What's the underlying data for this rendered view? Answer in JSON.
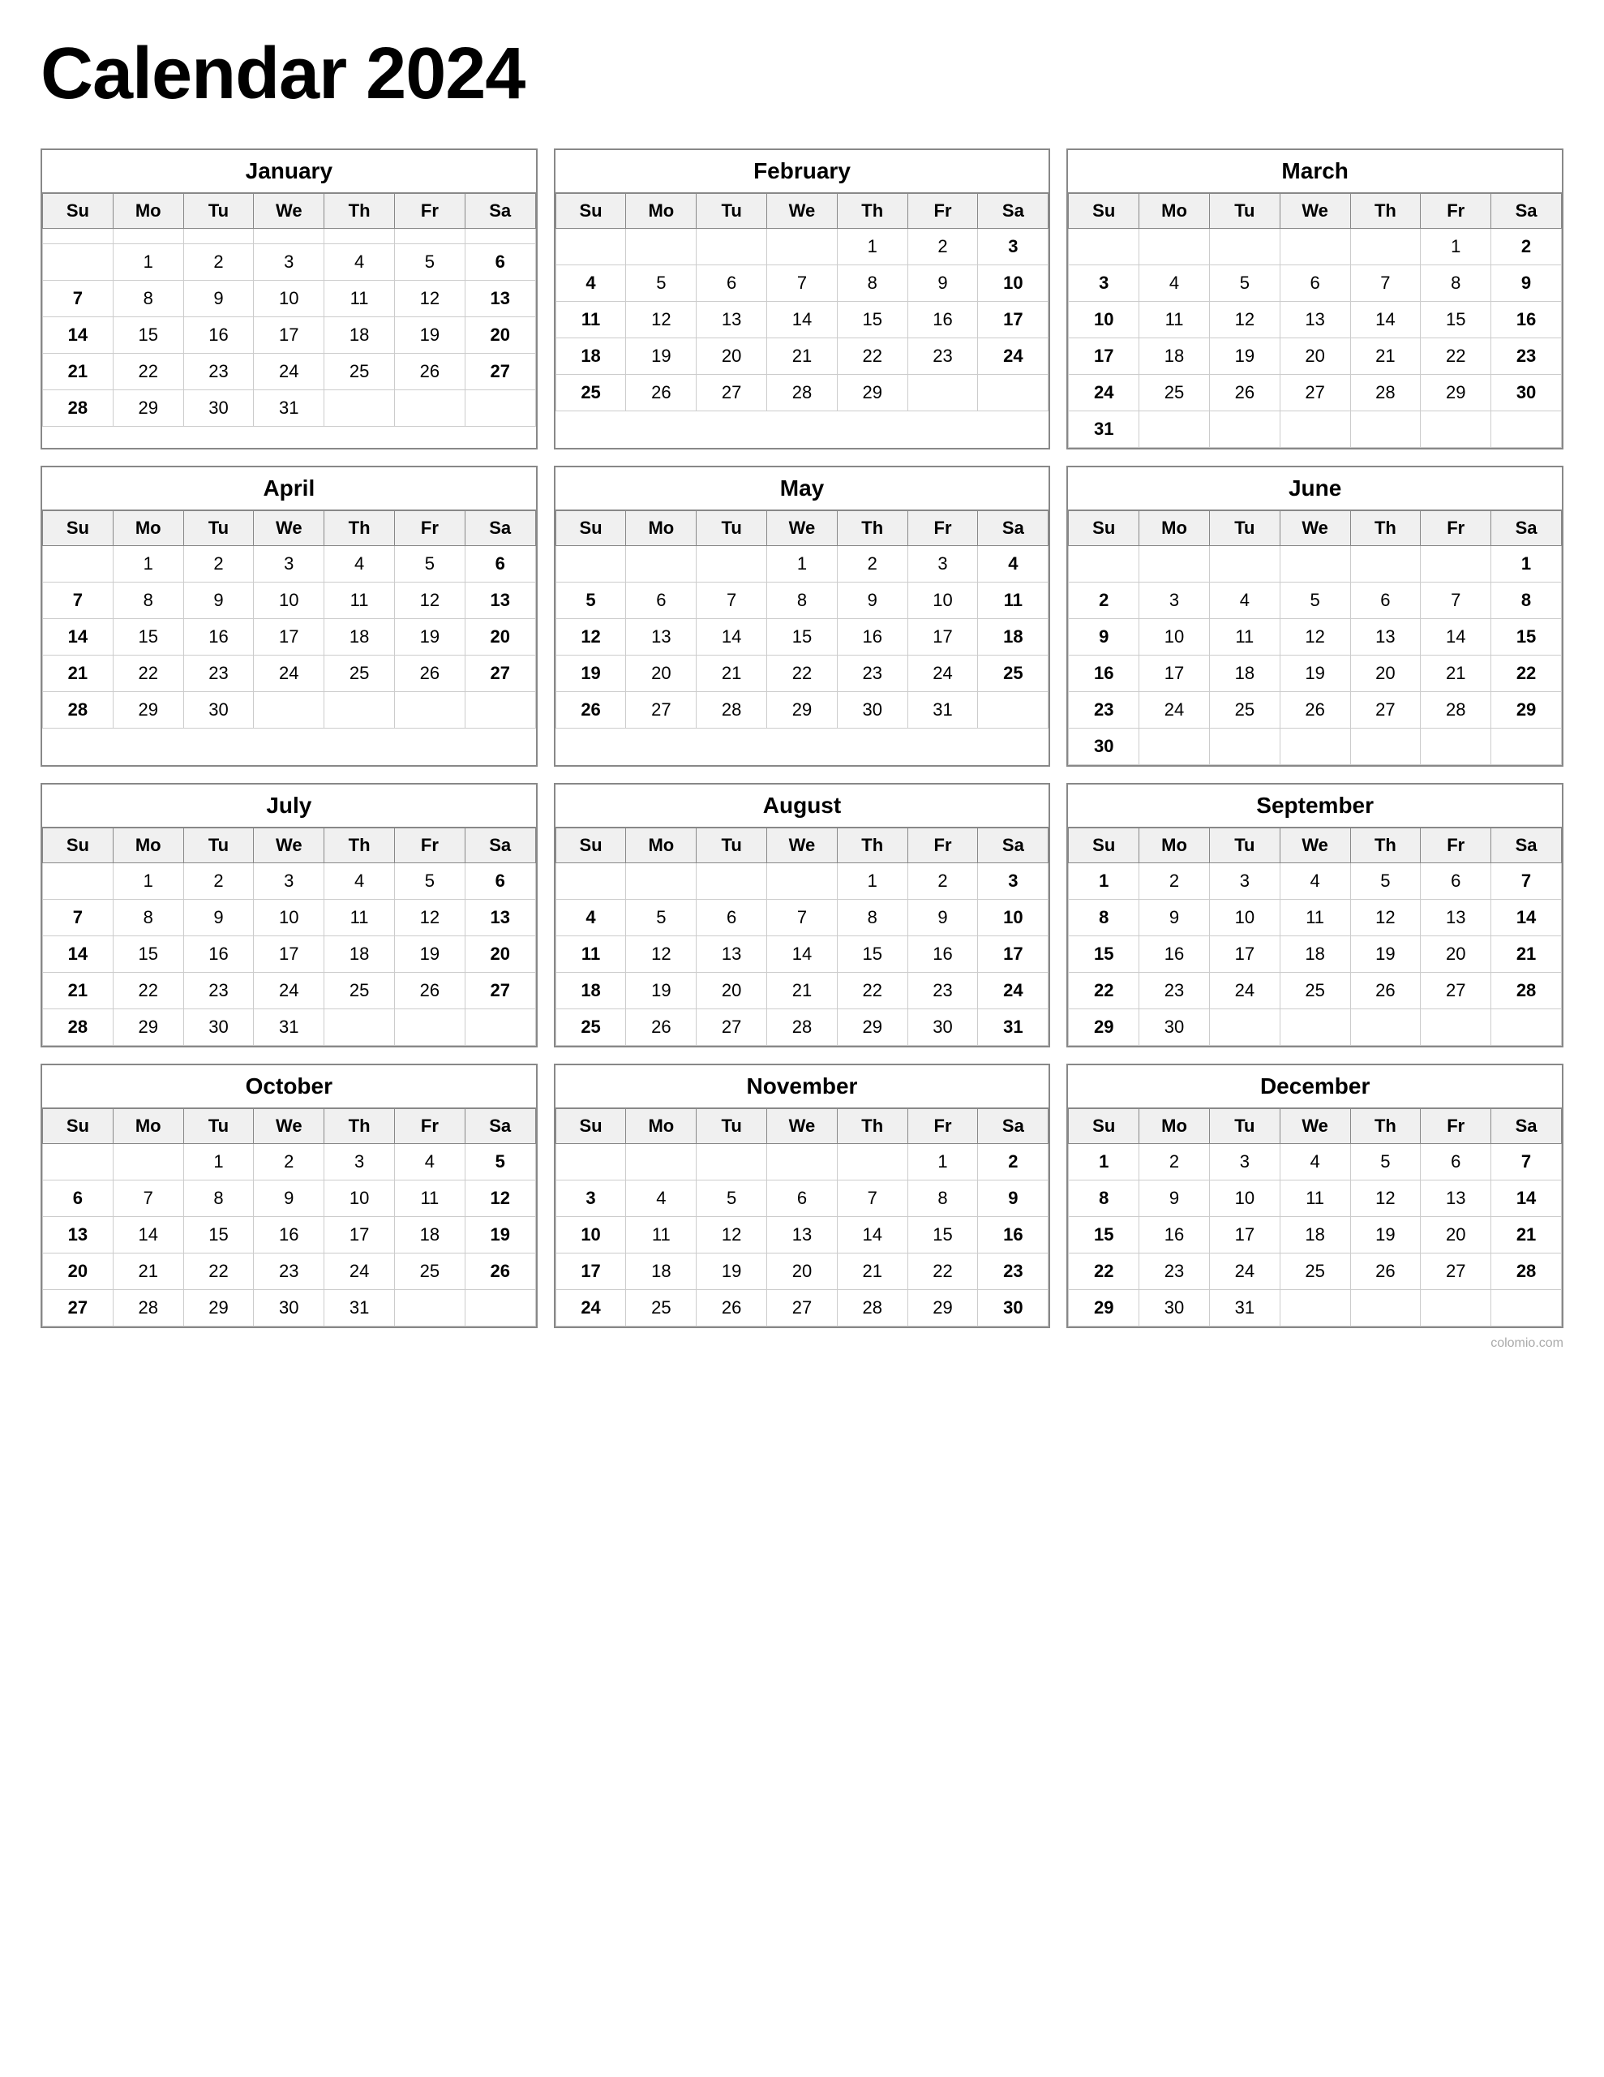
{
  "title": "Calendar 2024",
  "months": [
    {
      "name": "January",
      "headers": [
        "Su",
        "Mo",
        "Tu",
        "We",
        "Th",
        "Fr",
        "Sa"
      ],
      "weeks": [
        [
          "",
          "",
          "",
          "",
          "",
          "",
          ""
        ],
        [
          "",
          "1",
          "2",
          "3",
          "4",
          "5",
          "6"
        ],
        [
          "7",
          "8",
          "9",
          "10",
          "11",
          "12",
          "13"
        ],
        [
          "14",
          "15",
          "16",
          "17",
          "18",
          "19",
          "20"
        ],
        [
          "21",
          "22",
          "23",
          "24",
          "25",
          "26",
          "27"
        ],
        [
          "28",
          "29",
          "30",
          "31",
          "",
          "",
          ""
        ]
      ],
      "bold_cols": [
        0,
        6
      ]
    },
    {
      "name": "February",
      "headers": [
        "Su",
        "Mo",
        "Tu",
        "We",
        "Th",
        "Fr",
        "Sa"
      ],
      "weeks": [
        [
          "",
          "",
          "",
          "",
          "1",
          "2",
          "3"
        ],
        [
          "4",
          "5",
          "6",
          "7",
          "8",
          "9",
          "10"
        ],
        [
          "11",
          "12",
          "13",
          "14",
          "15",
          "16",
          "17"
        ],
        [
          "18",
          "19",
          "20",
          "21",
          "22",
          "23",
          "24"
        ],
        [
          "25",
          "26",
          "27",
          "28",
          "29",
          "",
          ""
        ]
      ],
      "bold_cols": [
        0,
        6
      ]
    },
    {
      "name": "March",
      "headers": [
        "Su",
        "Mo",
        "Tu",
        "We",
        "Th",
        "Fr",
        "Sa"
      ],
      "weeks": [
        [
          "",
          "",
          "",
          "",
          "",
          "1",
          "2"
        ],
        [
          "3",
          "4",
          "5",
          "6",
          "7",
          "8",
          "9"
        ],
        [
          "10",
          "11",
          "12",
          "13",
          "14",
          "15",
          "16"
        ],
        [
          "17",
          "18",
          "19",
          "20",
          "21",
          "22",
          "23"
        ],
        [
          "24",
          "25",
          "26",
          "27",
          "28",
          "29",
          "30"
        ],
        [
          "31",
          "",
          "",
          "",
          "",
          "",
          ""
        ]
      ],
      "bold_cols": [
        0,
        6
      ]
    },
    {
      "name": "April",
      "headers": [
        "Su",
        "Mo",
        "Tu",
        "We",
        "Th",
        "Fr",
        "Sa"
      ],
      "weeks": [
        [
          "",
          "1",
          "2",
          "3",
          "4",
          "5",
          "6"
        ],
        [
          "7",
          "8",
          "9",
          "10",
          "11",
          "12",
          "13"
        ],
        [
          "14",
          "15",
          "16",
          "17",
          "18",
          "19",
          "20"
        ],
        [
          "21",
          "22",
          "23",
          "24",
          "25",
          "26",
          "27"
        ],
        [
          "28",
          "29",
          "30",
          "",
          "",
          "",
          ""
        ]
      ],
      "bold_cols": [
        0,
        6
      ]
    },
    {
      "name": "May",
      "headers": [
        "Su",
        "Mo",
        "Tu",
        "We",
        "Th",
        "Fr",
        "Sa"
      ],
      "weeks": [
        [
          "",
          "",
          "",
          "1",
          "2",
          "3",
          "4"
        ],
        [
          "5",
          "6",
          "7",
          "8",
          "9",
          "10",
          "11"
        ],
        [
          "12",
          "13",
          "14",
          "15",
          "16",
          "17",
          "18"
        ],
        [
          "19",
          "20",
          "21",
          "22",
          "23",
          "24",
          "25"
        ],
        [
          "26",
          "27",
          "28",
          "29",
          "30",
          "31",
          ""
        ]
      ],
      "bold_cols": [
        0,
        6
      ]
    },
    {
      "name": "June",
      "headers": [
        "Su",
        "Mo",
        "Tu",
        "We",
        "Th",
        "Fr",
        "Sa"
      ],
      "weeks": [
        [
          "",
          "",
          "",
          "",
          "",
          "",
          "1"
        ],
        [
          "2",
          "3",
          "4",
          "5",
          "6",
          "7",
          "8"
        ],
        [
          "9",
          "10",
          "11",
          "12",
          "13",
          "14",
          "15"
        ],
        [
          "16",
          "17",
          "18",
          "19",
          "20",
          "21",
          "22"
        ],
        [
          "23",
          "24",
          "25",
          "26",
          "27",
          "28",
          "29"
        ],
        [
          "30",
          "",
          "",
          "",
          "",
          "",
          ""
        ]
      ],
      "bold_cols": [
        0,
        6
      ]
    },
    {
      "name": "July",
      "headers": [
        "Su",
        "Mo",
        "Tu",
        "We",
        "Th",
        "Fr",
        "Sa"
      ],
      "weeks": [
        [
          "",
          "1",
          "2",
          "3",
          "4",
          "5",
          "6"
        ],
        [
          "7",
          "8",
          "9",
          "10",
          "11",
          "12",
          "13"
        ],
        [
          "14",
          "15",
          "16",
          "17",
          "18",
          "19",
          "20"
        ],
        [
          "21",
          "22",
          "23",
          "24",
          "25",
          "26",
          "27"
        ],
        [
          "28",
          "29",
          "30",
          "31",
          "",
          "",
          ""
        ]
      ],
      "bold_cols": [
        0,
        6
      ]
    },
    {
      "name": "August",
      "headers": [
        "Su",
        "Mo",
        "Tu",
        "We",
        "Th",
        "Fr",
        "Sa"
      ],
      "weeks": [
        [
          "",
          "",
          "",
          "",
          "1",
          "2",
          "3"
        ],
        [
          "4",
          "5",
          "6",
          "7",
          "8",
          "9",
          "10"
        ],
        [
          "11",
          "12",
          "13",
          "14",
          "15",
          "16",
          "17"
        ],
        [
          "18",
          "19",
          "20",
          "21",
          "22",
          "23",
          "24"
        ],
        [
          "25",
          "26",
          "27",
          "28",
          "29",
          "30",
          "31"
        ]
      ],
      "bold_cols": [
        0,
        6
      ]
    },
    {
      "name": "September",
      "headers": [
        "Su",
        "Mo",
        "Tu",
        "We",
        "Th",
        "Fr",
        "Sa"
      ],
      "weeks": [
        [
          "1",
          "2",
          "3",
          "4",
          "5",
          "6",
          "7"
        ],
        [
          "8",
          "9",
          "10",
          "11",
          "12",
          "13",
          "14"
        ],
        [
          "15",
          "16",
          "17",
          "18",
          "19",
          "20",
          "21"
        ],
        [
          "22",
          "23",
          "24",
          "25",
          "26",
          "27",
          "28"
        ],
        [
          "29",
          "30",
          "",
          "",
          "",
          "",
          ""
        ]
      ],
      "bold_cols": [
        0,
        6
      ]
    },
    {
      "name": "October",
      "headers": [
        "Su",
        "Mo",
        "Tu",
        "We",
        "Th",
        "Fr",
        "Sa"
      ],
      "weeks": [
        [
          "",
          "",
          "1",
          "2",
          "3",
          "4",
          "5"
        ],
        [
          "6",
          "7",
          "8",
          "9",
          "10",
          "11",
          "12"
        ],
        [
          "13",
          "14",
          "15",
          "16",
          "17",
          "18",
          "19"
        ],
        [
          "20",
          "21",
          "22",
          "23",
          "24",
          "25",
          "26"
        ],
        [
          "27",
          "28",
          "29",
          "30",
          "31",
          "",
          ""
        ]
      ],
      "bold_cols": [
        0,
        6
      ]
    },
    {
      "name": "November",
      "headers": [
        "Su",
        "Mo",
        "Tu",
        "We",
        "Th",
        "Fr",
        "Sa"
      ],
      "weeks": [
        [
          "",
          "",
          "",
          "",
          "",
          "1",
          "2"
        ],
        [
          "3",
          "4",
          "5",
          "6",
          "7",
          "8",
          "9"
        ],
        [
          "10",
          "11",
          "12",
          "13",
          "14",
          "15",
          "16"
        ],
        [
          "17",
          "18",
          "19",
          "20",
          "21",
          "22",
          "23"
        ],
        [
          "24",
          "25",
          "26",
          "27",
          "28",
          "29",
          "30"
        ]
      ],
      "bold_cols": [
        0,
        6
      ]
    },
    {
      "name": "December",
      "headers": [
        "Su",
        "Mo",
        "Tu",
        "We",
        "Th",
        "Fr",
        "Sa"
      ],
      "weeks": [
        [
          "1",
          "2",
          "3",
          "4",
          "5",
          "6",
          "7"
        ],
        [
          "8",
          "9",
          "10",
          "11",
          "12",
          "13",
          "14"
        ],
        [
          "15",
          "16",
          "17",
          "18",
          "19",
          "20",
          "21"
        ],
        [
          "22",
          "23",
          "24",
          "25",
          "26",
          "27",
          "28"
        ],
        [
          "29",
          "30",
          "31",
          "",
          "",
          "",
          ""
        ]
      ],
      "bold_cols": [
        0,
        6
      ]
    }
  ],
  "watermark": "colomio.com"
}
